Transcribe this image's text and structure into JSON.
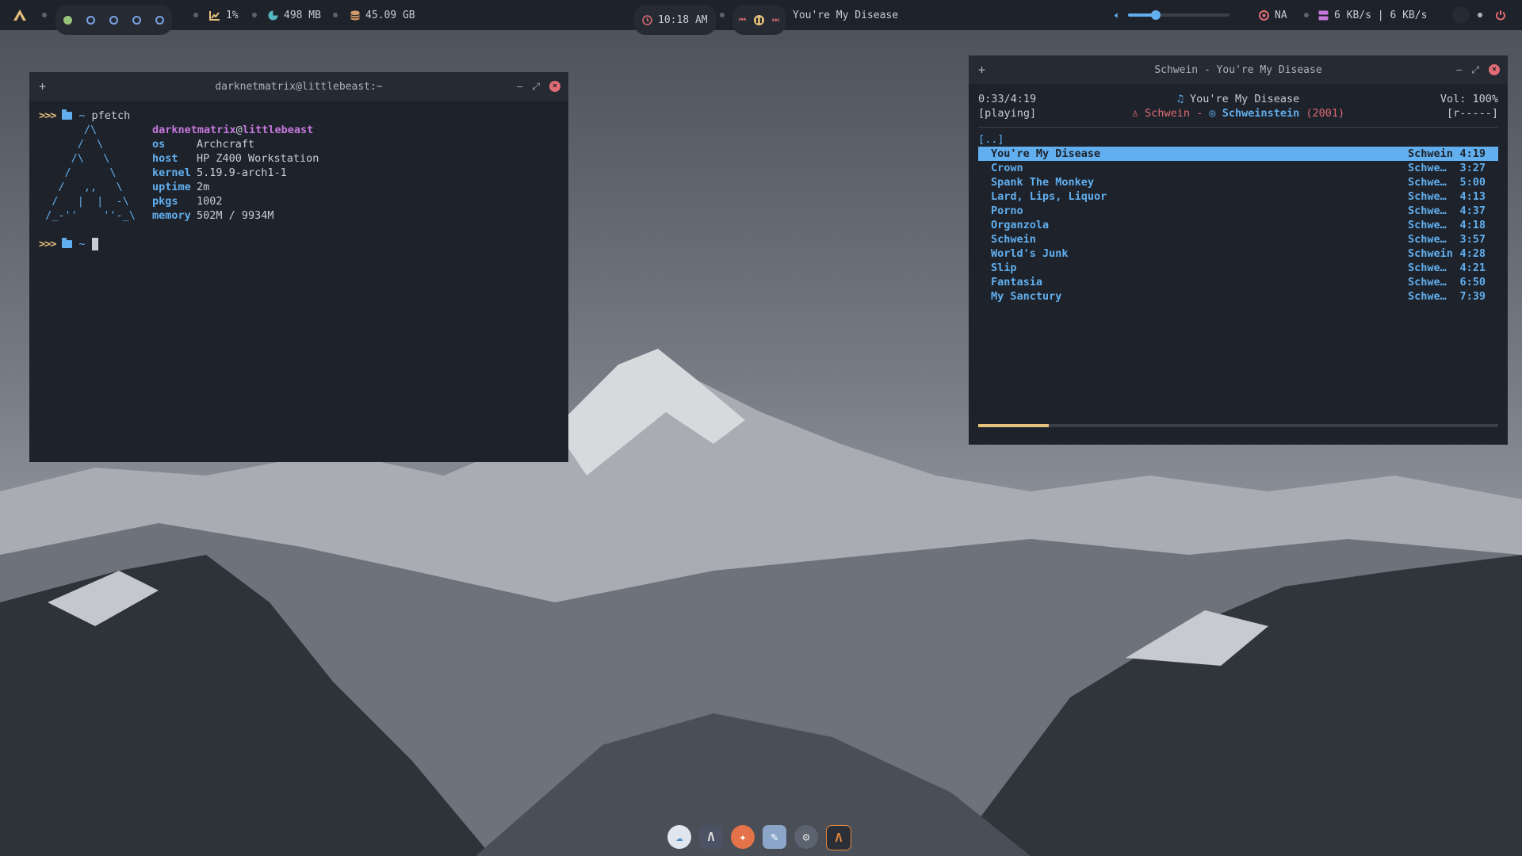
{
  "topbar": {
    "cpu": "1%",
    "memory": "498 MB",
    "disk": "45.09 GB",
    "clock": "10:18 AM",
    "now_playing": "You're My Disease",
    "volume_level": 0.27,
    "network_status": "NA",
    "traffic": "6 KB/s | 6 KB/s"
  },
  "terminal": {
    "title": "darknetmatrix@littlebeast:~",
    "command": "pfetch",
    "prompt_symbol": ">>>",
    "dir": "~",
    "ascii_logo": "       /\\\n      /  \\\n     /\\   \\\n    /      \\\n   /   ,,   \\\n  /   |  |  -\\\n /_-''    ''-_\\",
    "user": "darknetmatrix",
    "at": "@",
    "host_name": "littlebeast",
    "info": [
      {
        "key": "os",
        "value": "Archcraft"
      },
      {
        "key": "host",
        "value": "HP Z400 Workstation"
      },
      {
        "key": "kernel",
        "value": "5.19.9-arch1-1"
      },
      {
        "key": "uptime",
        "value": "2m"
      },
      {
        "key": "pkgs",
        "value": "1002"
      },
      {
        "key": "memory",
        "value": "502M / 9934M"
      }
    ]
  },
  "player": {
    "title": "Schwein - You're My Disease",
    "elapsed": "0:33/4:19",
    "state": "[playing]",
    "song": "You're My Disease",
    "artist": "Schwein",
    "dash": "-",
    "album": "Schweinstein",
    "year": "(2001)",
    "volume": "Vol: 100%",
    "flags": "[r-----]",
    "updir": "[..]",
    "progress": 0.135,
    "tracks": [
      {
        "title": "You're My Disease",
        "artist": "Schwein",
        "duration": "4:19"
      },
      {
        "title": "Crown",
        "artist": "Schwe…",
        "duration": "3:27"
      },
      {
        "title": "Spank The Monkey",
        "artist": "Schwe…",
        "duration": "5:00"
      },
      {
        "title": "Lard, Lips, Liquor",
        "artist": "Schwe…",
        "duration": "4:13"
      },
      {
        "title": "Porno",
        "artist": "Schwe…",
        "duration": "4:37"
      },
      {
        "title": "Organzola",
        "artist": "Schwe…",
        "duration": "4:18"
      },
      {
        "title": "Schwein",
        "artist": "Schwe…",
        "duration": "3:57"
      },
      {
        "title": "World's Junk",
        "artist": "Schwein",
        "duration": "4:28"
      },
      {
        "title": "Slip",
        "artist": "Schwe…",
        "duration": "4:21"
      },
      {
        "title": "Fantasia",
        "artist": "Schwe…",
        "duration": "6:50"
      },
      {
        "title": "My Sanctury",
        "artist": "Schwe…",
        "duration": "7:39"
      }
    ]
  },
  "colors": {
    "accent": "#61afef",
    "background": "#1e222a",
    "workspace_active": "#98c379"
  }
}
